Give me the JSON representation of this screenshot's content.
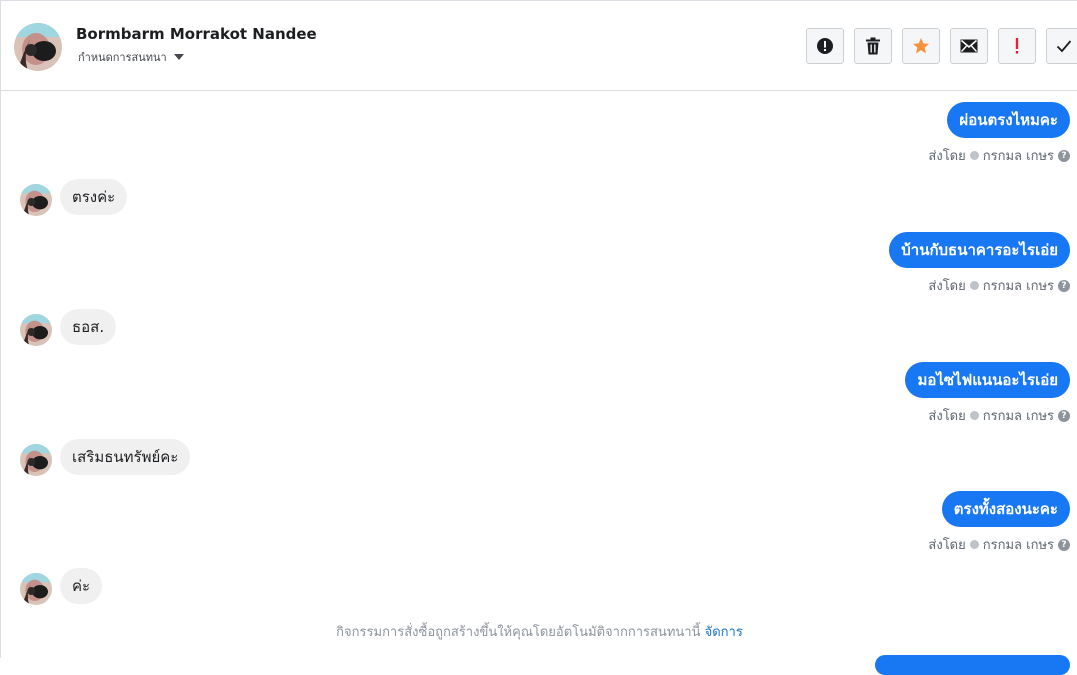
{
  "header": {
    "contact_name": "Bormbarm Morrakot Nandee",
    "subtitle": "กำหนดการสนทนา",
    "toolbar": [
      {
        "name": "spam-button",
        "icon": "exclamation-circle-icon",
        "color": "#1c1e21"
      },
      {
        "name": "delete-button",
        "icon": "trash-icon",
        "color": "#1c1e21"
      },
      {
        "name": "star-button",
        "icon": "star-icon",
        "color": "#f7923b"
      },
      {
        "name": "mark-unread-button",
        "icon": "envelope-icon",
        "color": "#1c1e21"
      },
      {
        "name": "follow-up-button",
        "icon": "exclamation-icon",
        "color": "#e41e3f"
      },
      {
        "name": "mark-done-button",
        "icon": "check-icon",
        "color": "#1c1e21"
      }
    ]
  },
  "conversation": {
    "sent_prefix": "ส่งโดย",
    "sender": "กรกมล เกษร",
    "help_glyph": "?",
    "messages": [
      {
        "dir": "out",
        "text": "ผ่อนตรงไหมคะ"
      },
      {
        "dir": "in",
        "text": "ตรงค่ะ"
      },
      {
        "dir": "out",
        "text": "บ้านกับธนาคารอะไรเอ่ย"
      },
      {
        "dir": "in",
        "text": "ธอส."
      },
      {
        "dir": "out",
        "text": "มอไซไฟแนนอะไรเอ่ย"
      },
      {
        "dir": "in",
        "text": "เสริมธนทรัพย์คะ"
      },
      {
        "dir": "out",
        "text": "ตรงทั้งสองนะคะ"
      },
      {
        "dir": "in",
        "text": "ค่ะ"
      }
    ],
    "footnote": {
      "text": "กิจกรรมการสั่งซื้อถูกสร้างขึ้นให้คุณโดยอัตโนมัติจากการสนทนานี้",
      "link": "จัดการ"
    }
  },
  "colors": {
    "accent": "#1877f2",
    "incoming_bubble": "#f0f0f0",
    "link": "#1876c4"
  }
}
